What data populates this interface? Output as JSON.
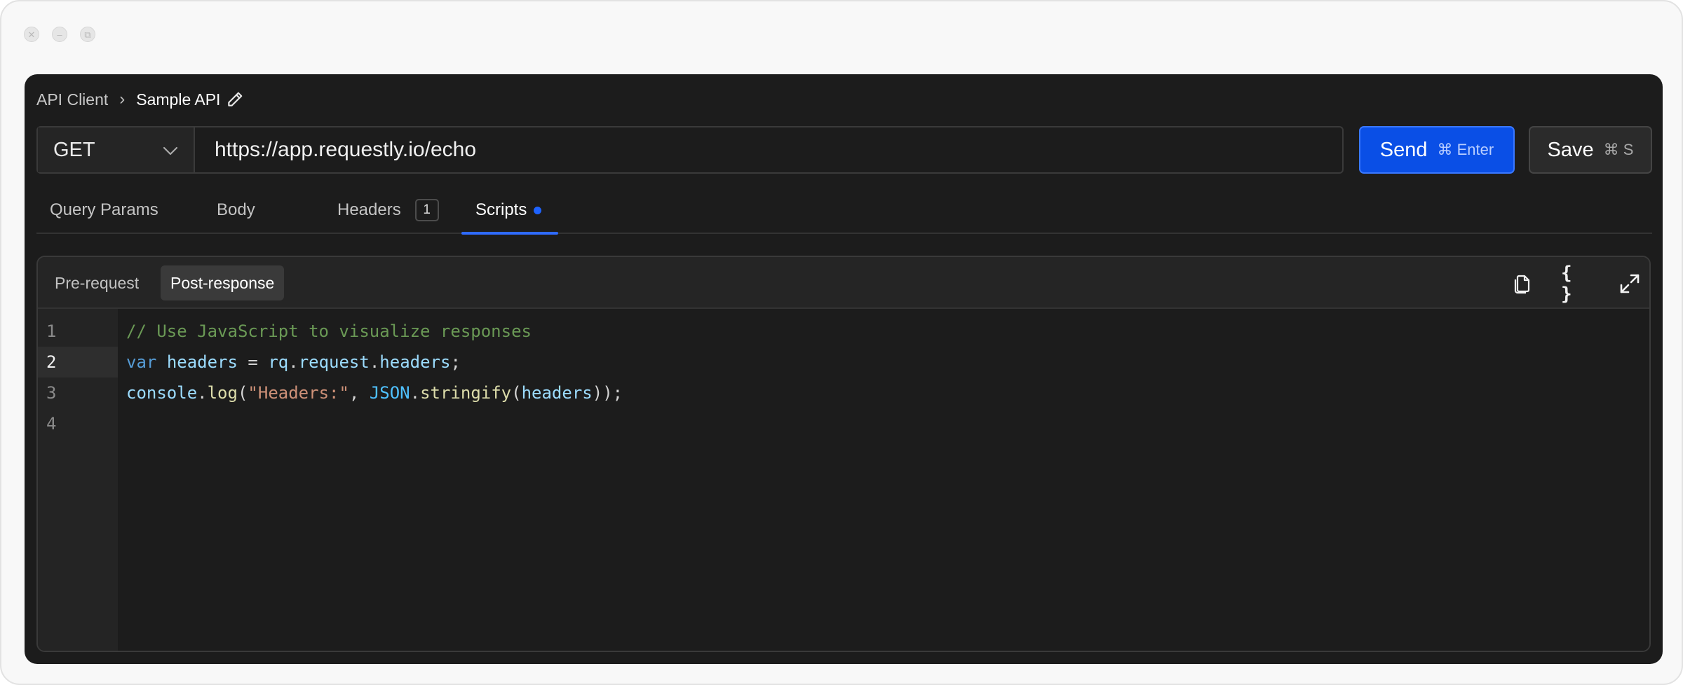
{
  "window": {
    "controls": [
      "close",
      "minimize",
      "maximize"
    ]
  },
  "breadcrumb": {
    "root": "API Client",
    "separator": "›",
    "current": "Sample API",
    "edit_icon": "pencil-icon"
  },
  "request": {
    "method": "GET",
    "url": "https://app.requestly.io/echo"
  },
  "actions": {
    "send_label": "Send",
    "send_shortcut": "⌘ Enter",
    "save_label": "Save",
    "save_shortcut": "⌘ S"
  },
  "tabs": [
    {
      "label": "Query Params"
    },
    {
      "label": "Body"
    },
    {
      "label": "Headers",
      "badge": "1"
    },
    {
      "label": "Scripts",
      "active": true,
      "indicator": "dot"
    }
  ],
  "scripts": {
    "subtabs": [
      {
        "label": "Pre-request"
      },
      {
        "label": "Post-response",
        "active": true
      }
    ],
    "toolbar_icons": [
      "copy-icon",
      "braces-icon",
      "expand-icon"
    ],
    "braces_glyph": "{ }",
    "lines": [
      {
        "number": "1",
        "text": "// Use JavaScript to visualize responses"
      },
      {
        "number": "2",
        "text": "var headers = rq.request.headers;",
        "current": true
      },
      {
        "number": "3",
        "text": "console.log(\"Headers:\", JSON.stringify(headers));"
      },
      {
        "number": "4",
        "text": ""
      }
    ]
  },
  "colors": {
    "accent": "#0a4fe6",
    "background": "#1c1c1c",
    "tab_indicator": "#2f6bff"
  }
}
